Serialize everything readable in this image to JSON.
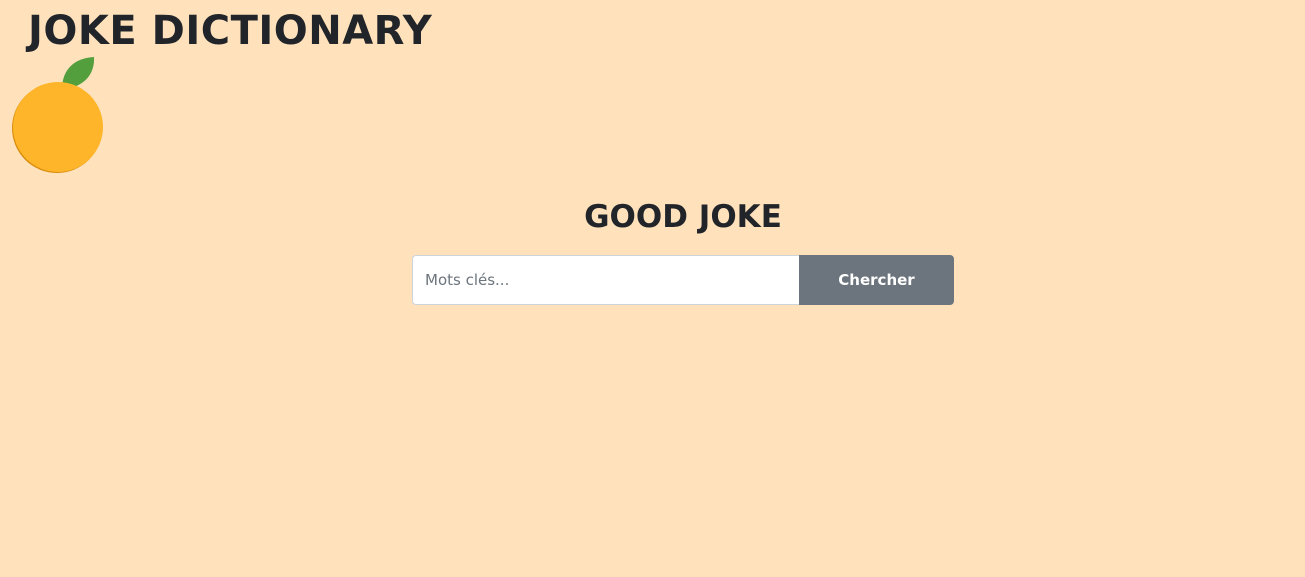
{
  "header": {
    "title": "JOKE DICTIONARY",
    "logo_icon": "orange-fruit-icon"
  },
  "main": {
    "heading": "GOOD JOKE",
    "search": {
      "placeholder": "Mots clés...",
      "value": "",
      "button_label": "Chercher"
    }
  },
  "colors": {
    "background": "#ffe2bc",
    "text": "#212529",
    "orange": "#ffb52a",
    "orange_shadow": "#d98c0a",
    "leaf": "#539e3d",
    "button": "#6c757d"
  }
}
